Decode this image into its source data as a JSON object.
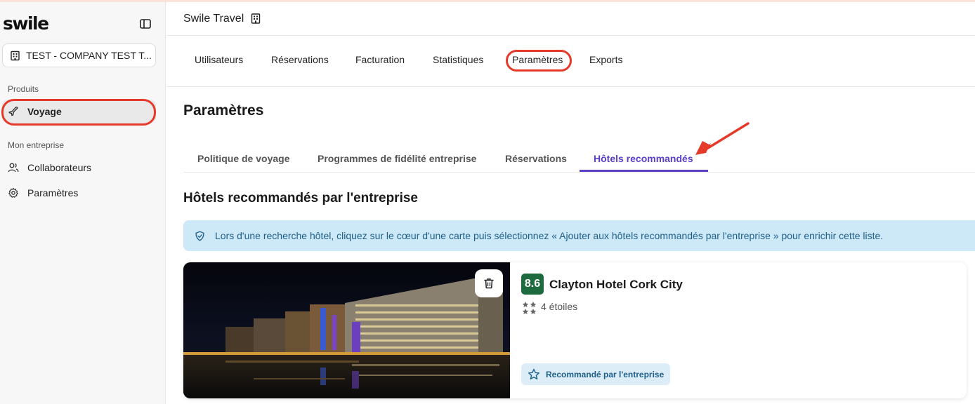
{
  "sidebar": {
    "logo": "swile",
    "company": "TEST - COMPANY TEST T...",
    "section_products": "Produits",
    "item_voyage": "Voyage",
    "section_company": "Mon entreprise",
    "item_collaborateurs": "Collaborateurs",
    "item_parametres": "Paramètres"
  },
  "header": {
    "title": "Swile Travel"
  },
  "top_tabs": [
    {
      "label": "Utilisateurs"
    },
    {
      "label": "Réservations"
    },
    {
      "label": "Facturation"
    },
    {
      "label": "Statistiques"
    },
    {
      "label": "Paramètres",
      "active": true
    },
    {
      "label": "Exports"
    }
  ],
  "page": {
    "title": "Paramètres",
    "subtabs": [
      {
        "label": "Politique de voyage"
      },
      {
        "label": "Programmes de fidélité entreprise"
      },
      {
        "label": "Réservations"
      },
      {
        "label": "Hôtels recommandés",
        "active": true
      }
    ],
    "section_title": "Hôtels recommandés par l'entreprise",
    "info_message": "Lors d'une recherche hôtel, cliquez sur le cœur d'une carte puis sélectionnez « Ajouter aux hôtels recommandés par l'entreprise » pour enrichir cette liste."
  },
  "hotel": {
    "rating": "8.6",
    "name": "Clayton Hotel Cork City",
    "stars_label": "4 étoiles",
    "badge": "Recommandé par l'entreprise"
  },
  "colors": {
    "accent_purple": "#5b3fc4",
    "highlight_red": "#e53a2a",
    "rating_green": "#1e6a3f",
    "info_bg": "#cde8f6"
  }
}
